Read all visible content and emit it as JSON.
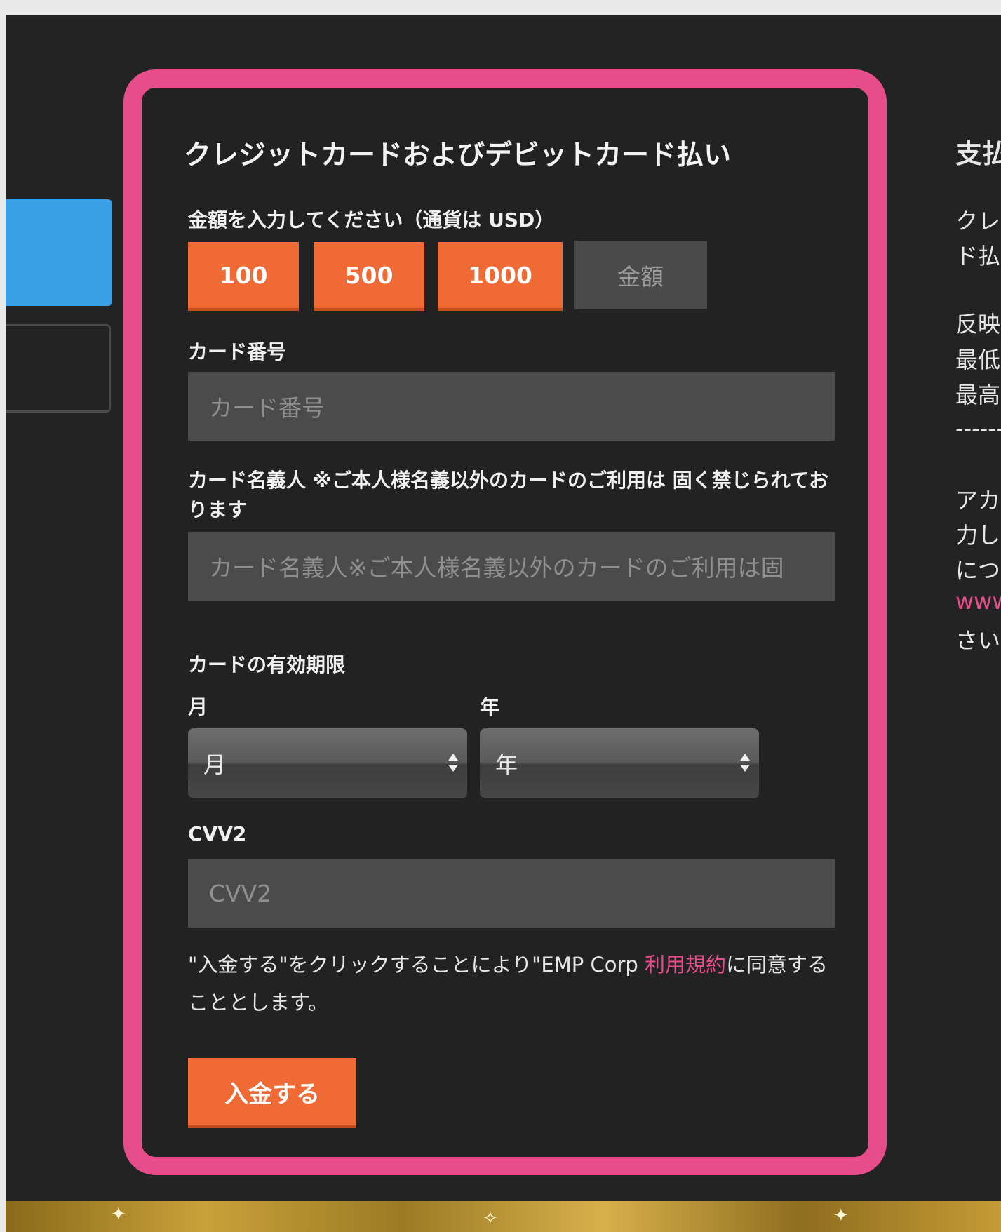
{
  "form": {
    "title": "クレジットカードおよびデビットカード払い",
    "amount_label": "金額を入力してください（通貨は USD）",
    "amount_buttons": [
      "100",
      "500",
      "1000"
    ],
    "amount_placeholder": "金額",
    "card_number_label": "カード番号",
    "card_number_placeholder": "カード番号",
    "card_holder_label": "カード名義人 ※ご本人様名義以外のカードのご利用は 固く禁じられております",
    "card_holder_placeholder": "カード名義人※ご本人様名義以外のカードのご利用は固",
    "expiry_label": "カードの有効期限",
    "month_label": "月",
    "year_label": "年",
    "month_select_value": "月",
    "year_select_value": "年",
    "cvv_label": "CVV2",
    "cvv_placeholder": "CVV2",
    "terms_before": "\"入金する\"をクリックすることにより\"EMP Corp ",
    "terms_link": "利用規約",
    "terms_after": "に同意することとします。",
    "submit_label": "入金する"
  },
  "side_panel": {
    "title": "支払",
    "lines": [
      "クレ",
      "ド払",
      "反映",
      "最低",
      "最高",
      "------",
      "アカ",
      "力し",
      "につ",
      "www",
      "さい"
    ]
  },
  "colors": {
    "frame": "#e64d8a",
    "accent": "#f06a36",
    "tab_active": "#3aa0e6",
    "link": "#e64d8a"
  }
}
